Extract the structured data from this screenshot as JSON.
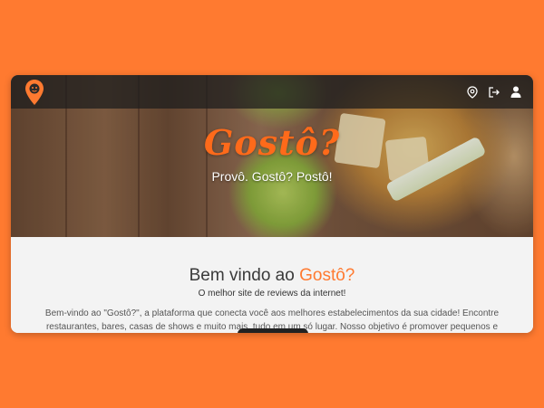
{
  "navbar": {
    "logo_icon": "map-pin-logo",
    "icons": [
      "location-icon",
      "logout-icon",
      "user-icon"
    ]
  },
  "hero": {
    "brand": "Gostô?",
    "tagline": "Provô. Gostô? Postô!"
  },
  "content": {
    "welcome_prefix": "Bem vindo ao ",
    "welcome_accent": "Gostô?",
    "subtitle": "O melhor site de reviews da internet!",
    "description": "Bem-vindo ao \"Gostô?\", a plataforma que conecta você aos melhores estabelecimentos da sua cidade! Encontre restaurantes, bares, casas de shows e muito mais, tudo em um só lugar. Nosso objetivo é promover pequenos e"
  },
  "colors": {
    "background": "#ff7a30",
    "accent": "#ff6a1a",
    "navbar": "#1e1e1e"
  }
}
